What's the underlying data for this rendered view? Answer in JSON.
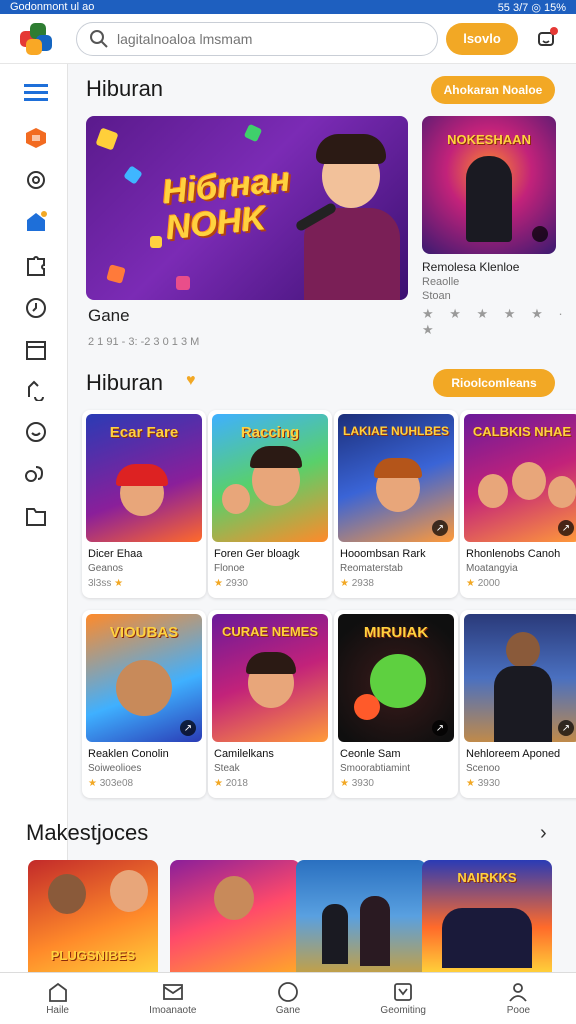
{
  "status_bar": {
    "left_text": "Godonmont ul ao",
    "right_text": "55 3/7  ◎  15%"
  },
  "header": {
    "search_placeholder": "lagitalnoaloa lmsmam",
    "signin_label": "lsovlo",
    "icons": [
      "app-logo",
      "search-icon",
      "bell-icon"
    ]
  },
  "sidebar": {
    "items": [
      "menu-icon",
      "game-icon",
      "headset-icon",
      "home-icon",
      "puzzle-icon",
      "clock-icon",
      "calendar-icon",
      "controller-icon",
      "smile-icon",
      "link-icon",
      "folder-icon"
    ]
  },
  "section1": {
    "title": "Hiburan",
    "action_label": "Ahokaran Noaloe",
    "hero": {
      "title_line1": "Hiбrнан",
      "title_line2": "NOHK",
      "caption": "Gane",
      "meta": "2 1 91 - 3: -2 3 0 1 3 M"
    },
    "side_card": {
      "title": "Remolesa Klenloe",
      "sub": "Reaolle",
      "sub2": "Stoan",
      "rating_text": "★ ★ ★ ★  ★ ·  ★",
      "thumb_word": "NOKESHAAN"
    }
  },
  "section2": {
    "title": "Hiburan",
    "action_label": "Rioolcomleans",
    "row1": [
      {
        "thumb_word": "Ecar Fare",
        "title": "Dicer Ehaa",
        "sub": "Geanos",
        "rating": "3l3ss",
        "badge": "↗"
      },
      {
        "thumb_word": "Raccing",
        "title": "Foren Ger bloagk",
        "sub": "Flonoe",
        "rating": "2930",
        "badge": "↗"
      },
      {
        "thumb_word": "LAKIAE NUHLBES",
        "title": "Hooombsan Rark",
        "sub": "Reomaterstab",
        "rating": "2938",
        "badge": "↗"
      },
      {
        "thumb_word": "CALBKIS NHAE",
        "title": "Rhonlenobs Canoh",
        "sub": "Moatangyia",
        "rating": "2000",
        "badge": "↗"
      }
    ],
    "row2": [
      {
        "thumb_word": "VIOUBAS",
        "title": "Reaklen Conolin",
        "sub": "Soiweolioes",
        "rating": "303e08",
        "badge": "↗"
      },
      {
        "thumb_word": "CURAE NEMES",
        "title": "Camilelkans",
        "sub": "Steak",
        "rating": "2018",
        "badge": "↗"
      },
      {
        "thumb_word": "MIRUIAK",
        "title": "Ceonle Sam",
        "sub": "Smoorabtiamint",
        "rating": "3930",
        "badge": "↗"
      },
      {
        "thumb_word": "",
        "title": "Nehloreem Aponed",
        "sub": "Scenoo",
        "rating": "3930",
        "badge": "↗"
      }
    ]
  },
  "section3": {
    "title": "Makestjoces",
    "thumbs": [
      "PLUGSNIBES",
      "",
      "",
      "NAIRKKS"
    ]
  },
  "bottom_nav": [
    {
      "icon": "home-icon",
      "label": "Haile"
    },
    {
      "icon": "inbox-icon",
      "label": "Imoanaote"
    },
    {
      "icon": "compass-icon",
      "label": "Gane"
    },
    {
      "icon": "tray-icon",
      "label": "Geomiting"
    },
    {
      "icon": "user-icon",
      "label": "Pooe"
    }
  ],
  "colors": {
    "accent": "#f2a825",
    "status_bar": "#1e5fbf",
    "card_bg": "#ffffff"
  }
}
